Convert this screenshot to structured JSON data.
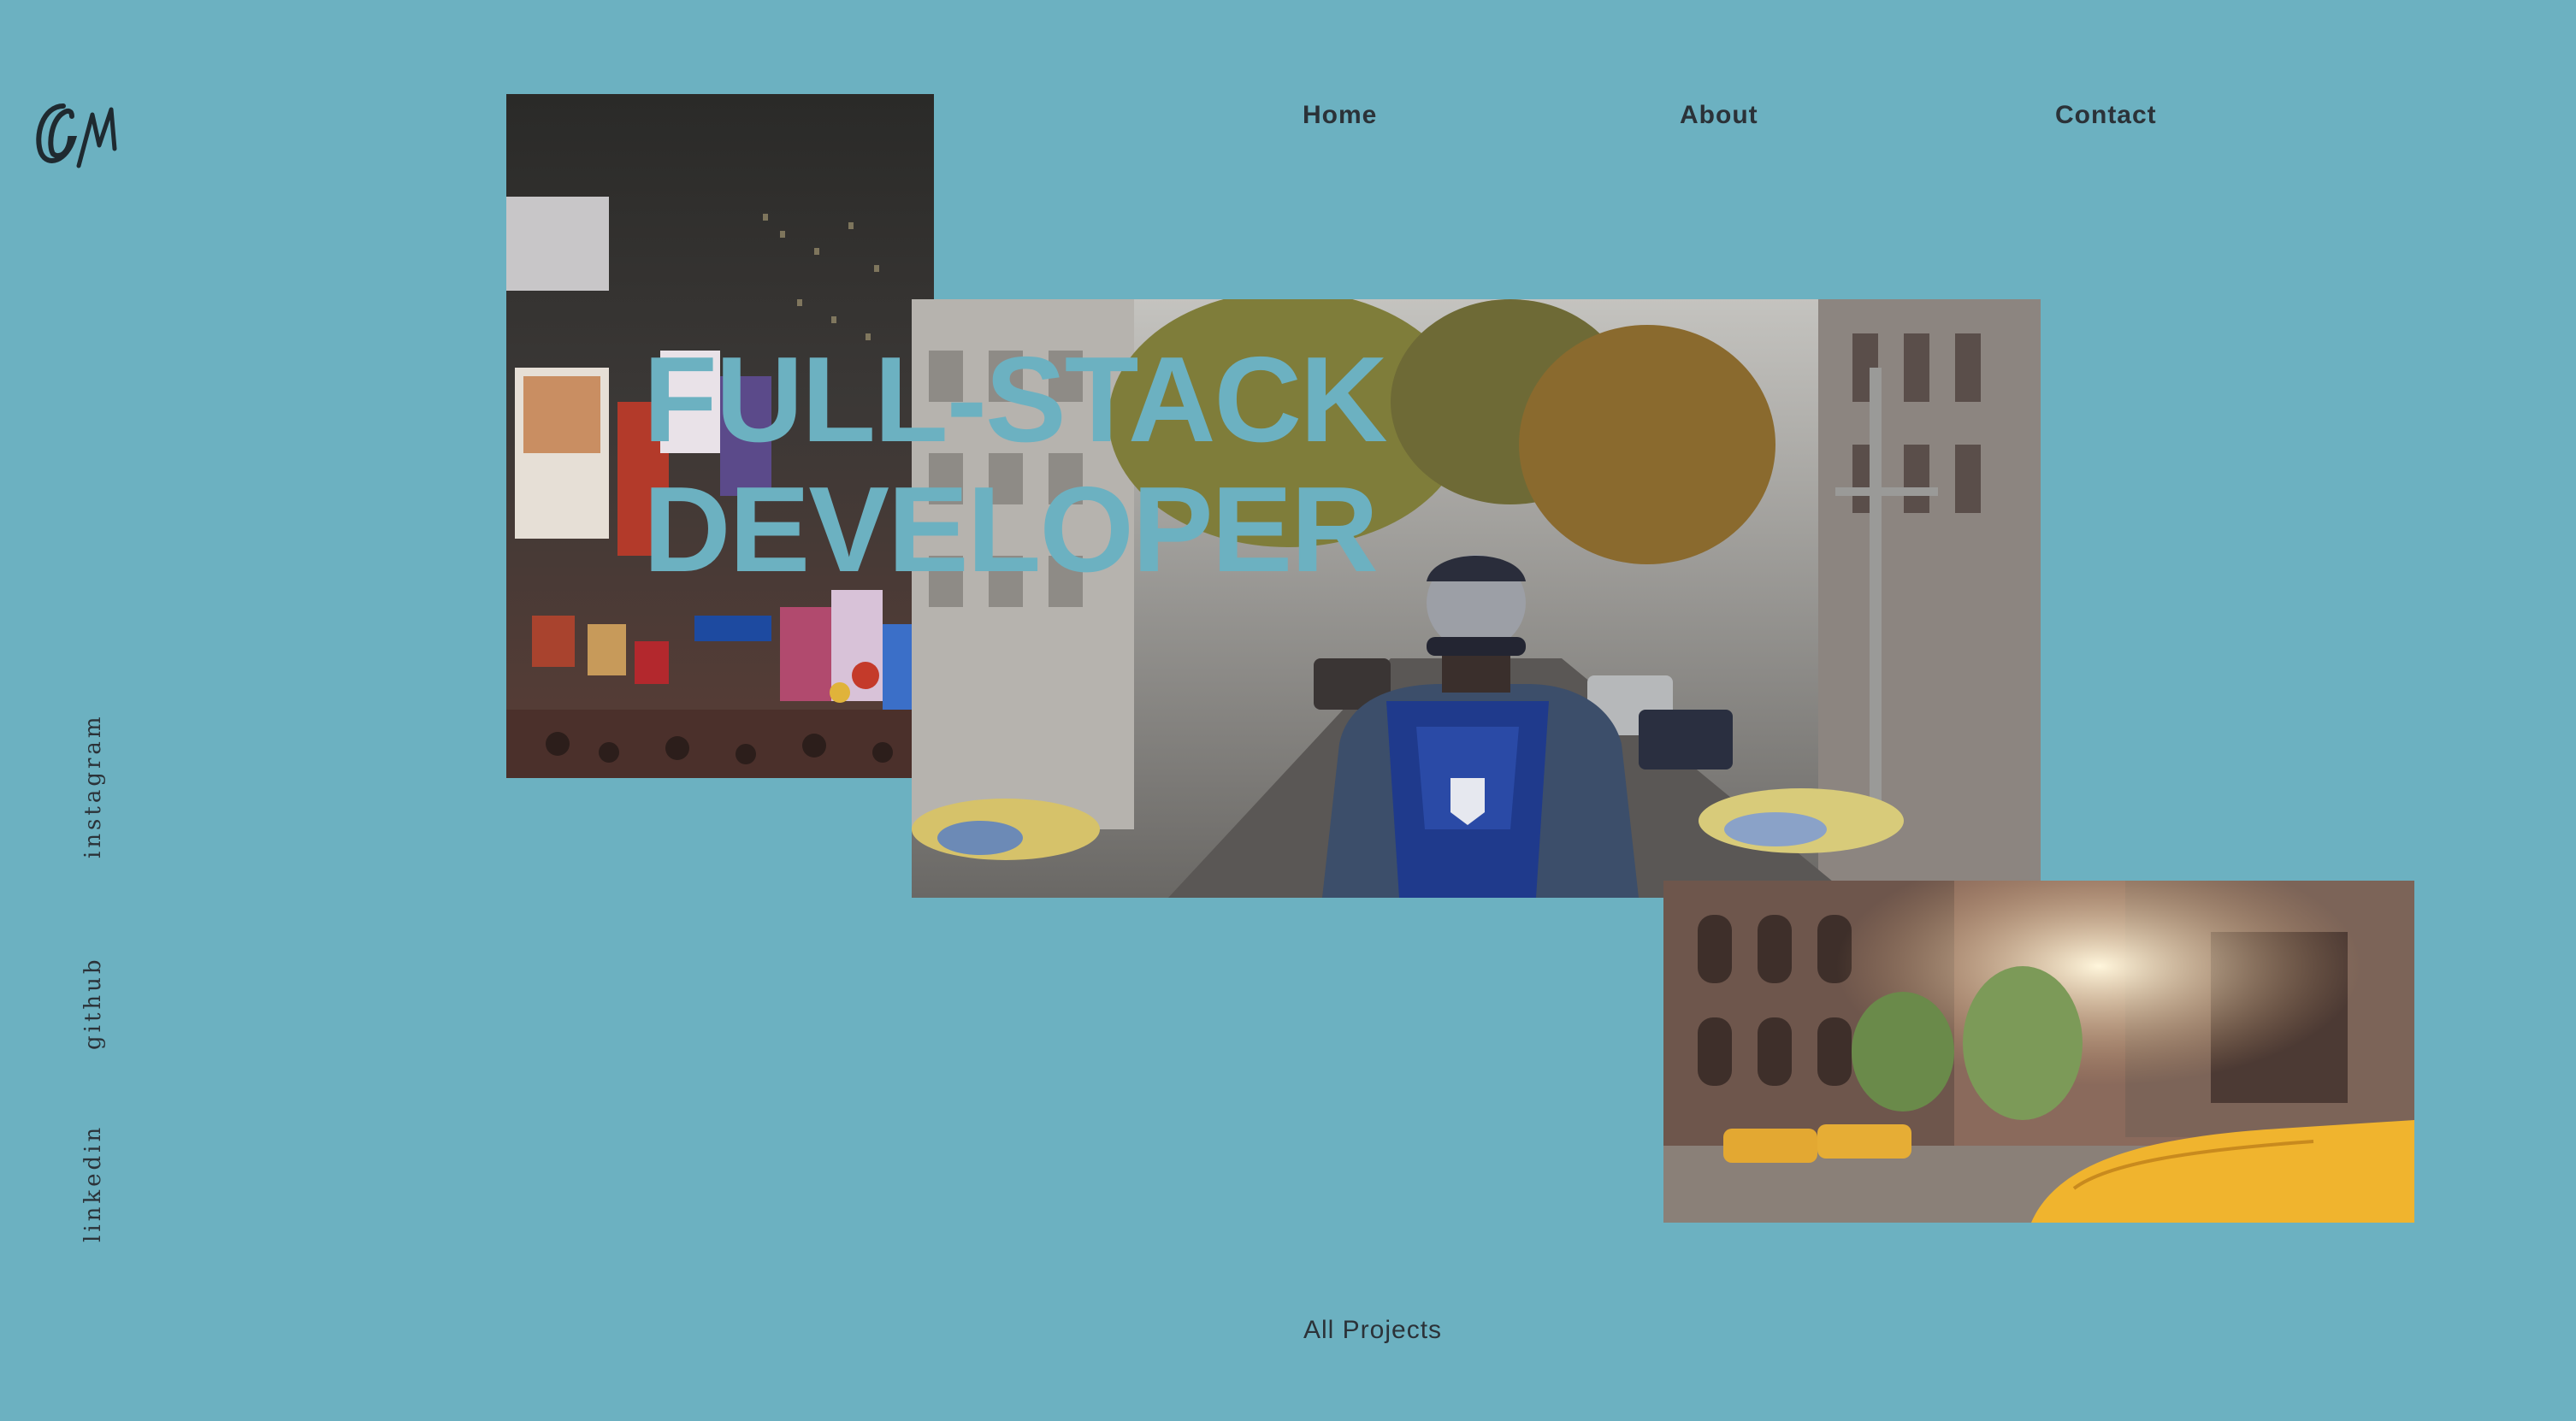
{
  "logo": {
    "text": "GM",
    "icon": "signature-logo-icon"
  },
  "nav": {
    "items": [
      "Home",
      "About",
      "Contact"
    ]
  },
  "social": {
    "items": [
      "instagram",
      "github",
      "linkedin"
    ]
  },
  "hero": {
    "line1": "FULL-STACK",
    "line2": "DEVELOPER"
  },
  "footer": {
    "all_projects": "All Projects"
  },
  "colors": {
    "background": "#6cb1c1",
    "text": "#2b3238",
    "headline": "#6cb1c1"
  },
  "images": {
    "left": "night-times-square-billboards",
    "center": "man-with-backpack-on-city-street",
    "right": "street-with-yellow-taxis"
  }
}
